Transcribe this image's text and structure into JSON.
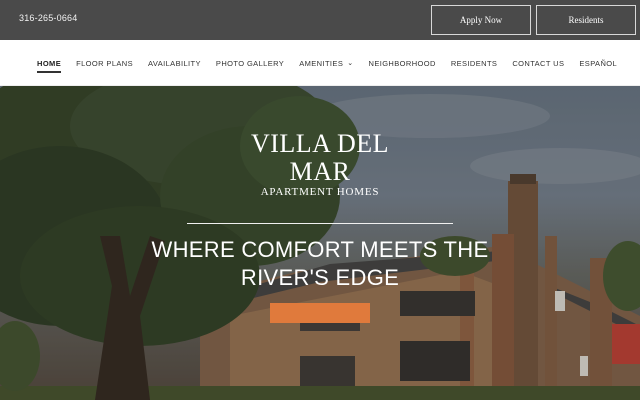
{
  "topbar": {
    "phone": "316-265-0664",
    "apply_label": "Apply Now",
    "residents_label": "Residents"
  },
  "nav": {
    "items": [
      {
        "label": "HOME"
      },
      {
        "label": "FLOOR PLANS"
      },
      {
        "label": "AVAILABILITY"
      },
      {
        "label": "PHOTO GALLERY"
      },
      {
        "label": "AMENITIES"
      },
      {
        "label": "NEIGHBORHOOD"
      },
      {
        "label": "RESIDENTS"
      },
      {
        "label": "CONTACT US"
      },
      {
        "label": "ESPAÑOL"
      }
    ]
  },
  "hero": {
    "brand_line1": "VILLA DEL",
    "brand_line2": "MAR",
    "brand_sub": "APARTMENT HOMES",
    "tagline": "WHERE COMFORT MEETS THE RIVER'S EDGE"
  },
  "colors": {
    "topbar": "#4a4a4a",
    "cta": "#e07a3c"
  }
}
